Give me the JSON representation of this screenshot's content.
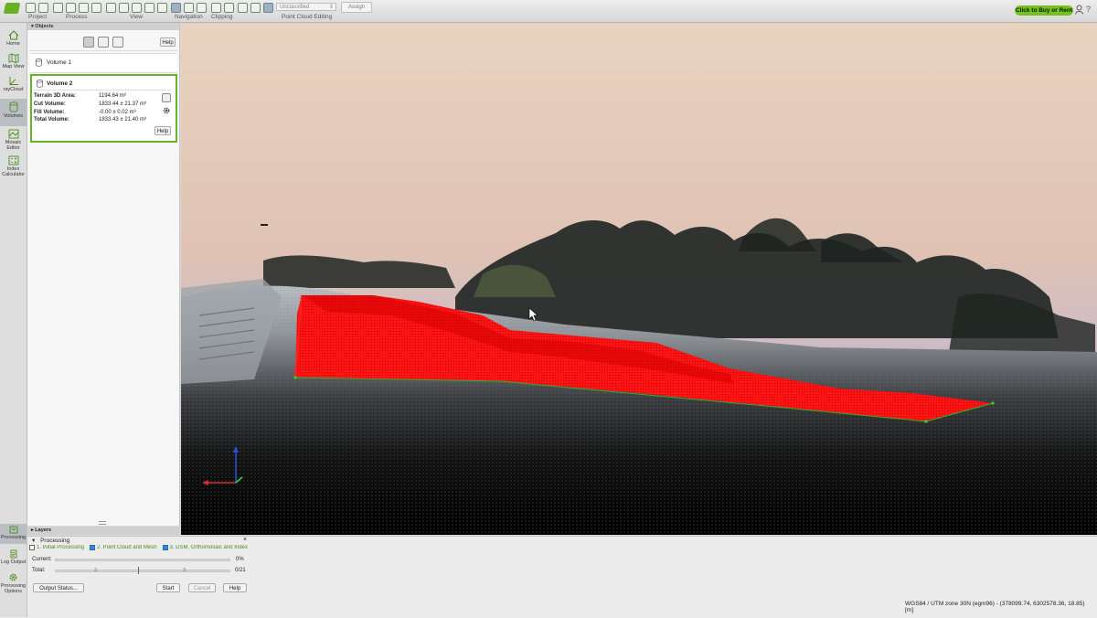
{
  "toolbar": {
    "groups": [
      "Project",
      "Process",
      "View",
      "Navigation",
      "Clipping",
      "Point Cloud Editing"
    ],
    "classification_value": "Unclassified",
    "assign_label": "Assign",
    "buy_label": "Click to Buy or Rent",
    "help_glyph": "?"
  },
  "sidebar": {
    "items": [
      {
        "label": "Home",
        "icon": "home-icon"
      },
      {
        "label": "Map View",
        "icon": "map-icon"
      },
      {
        "label": "rayCloud",
        "icon": "raycloud-icon"
      },
      {
        "label": "Volumes",
        "icon": "volumes-icon"
      },
      {
        "label": "Mosaic Editor",
        "icon": "mosaic-icon"
      },
      {
        "label": "Index Calculator",
        "icon": "index-calculator-icon"
      }
    ],
    "bottom_items": [
      {
        "label": "Processing",
        "icon": "processing-icon"
      },
      {
        "label": "Log Output",
        "icon": "log-icon"
      },
      {
        "label": "Processing Options",
        "icon": "gear-icon"
      }
    ]
  },
  "objects": {
    "header": "Objects",
    "help_label": "Help",
    "volume1": {
      "name": "Volume 1"
    },
    "volume2": {
      "name": "Volume 2",
      "rows": [
        {
          "label": "Terrain 3D Area:",
          "value": "1194.64 m²"
        },
        {
          "label": "Cut Volume:",
          "value": "1833.44 ± 21.37 m³"
        },
        {
          "label": "Fill Volume:",
          "value": "-0.00 ± 0.02 m³"
        },
        {
          "label": "Total Volume:",
          "value": "1833.43 ± 21.40 m³"
        }
      ],
      "help_label": "Help"
    }
  },
  "layers": {
    "header": "Layers"
  },
  "processing": {
    "header": "Processing",
    "close_glyph": "×",
    "steps": [
      "1. Initial Processing",
      "2. Point Cloud and Mesh",
      "3. DSM, Orthomosaic and Index"
    ],
    "current_label": "Current:",
    "current_value": "0%",
    "total_label": "Total:",
    "total_value": "0/21",
    "total_markers": [
      "2.",
      "3."
    ],
    "output_status_label": "Output Status...",
    "start_label": "Start",
    "cancel_label": "Cancel",
    "help_label": "Help"
  },
  "status_bar": {
    "coords": "WGS84 / UTM zone 30N (egm96) - (378099.74, 6302578.36, 18.85) [m]"
  },
  "colors": {
    "accent_green": "#69b22a",
    "volume_red": "#ff1010",
    "buy_button": "#74c21d"
  }
}
